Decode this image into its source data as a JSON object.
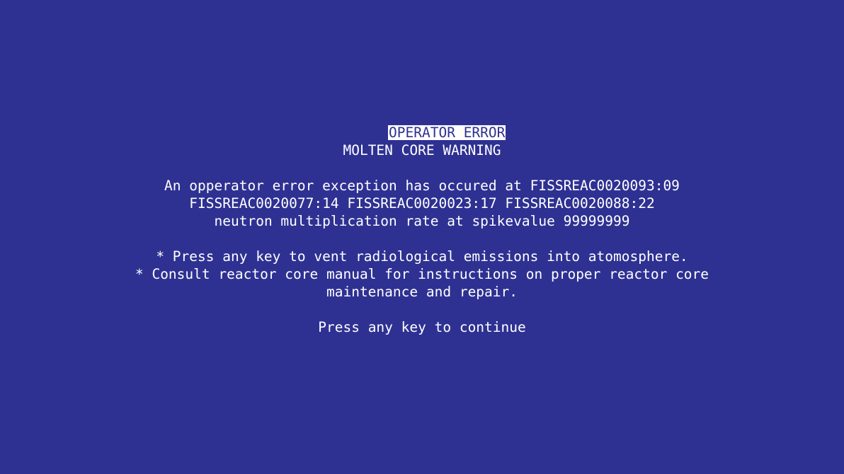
{
  "screen": {
    "background_color": "#2e3192",
    "text_color": "#ffffff",
    "title": "OPERATOR ERROR",
    "heading": "MOLTEN CORE WARNING",
    "message_lines": [
      "An opperator error exception has occured at FISSREAC0020093:09",
      "FISSREAC0020077:14 FISSREAC0020023:17 FISSREAC0020088:22",
      "neutron multiplication rate at spikevalue 99999999"
    ],
    "instruction_lines": [
      "* Press any key to vent radiological emissions into atomosphere.",
      "* Consult reactor core manual for instructions on proper reactor core",
      "maintenance and repair."
    ],
    "continue_prompt": "Press any key to continue"
  }
}
